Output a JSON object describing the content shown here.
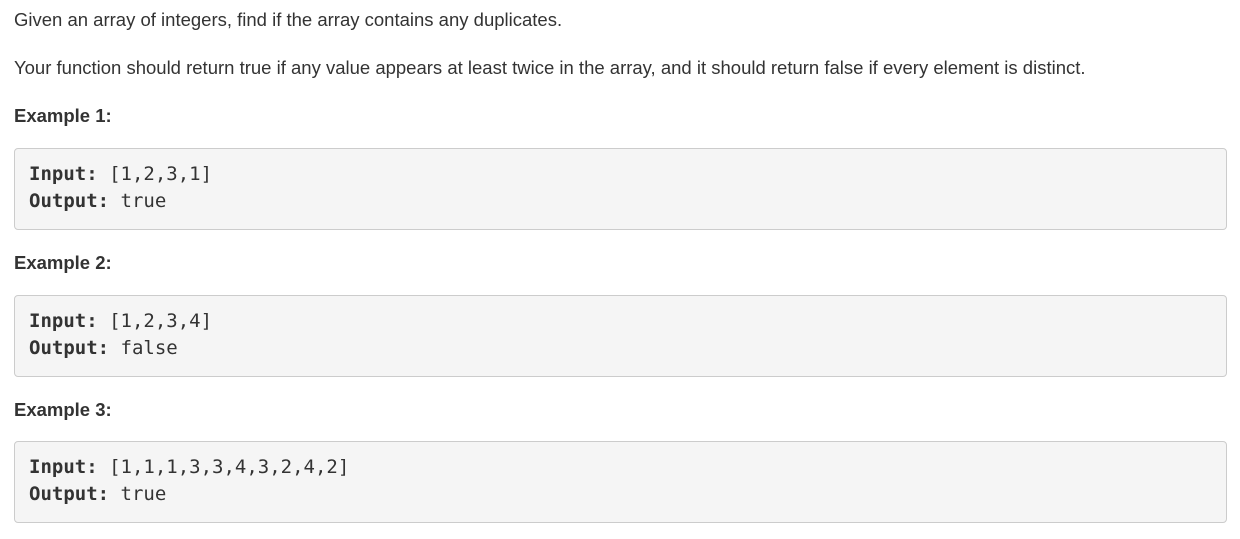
{
  "problem": {
    "statement": "Given an array of integers, find if the array contains any duplicates.",
    "description": "Your function should return true if any value appears at least twice in the array, and it should return false if every element is distinct."
  },
  "examples": [
    {
      "heading": "Example 1:",
      "input_label": "Input:",
      "input_value": " [1,2,3,1]",
      "output_label": "Output:",
      "output_value": " true"
    },
    {
      "heading": "Example 2:",
      "input_label": "Input:",
      "input_value": " [1,2,3,4]",
      "output_label": "Output:",
      "output_value": " false"
    },
    {
      "heading": "Example 3:",
      "input_label": "Input:",
      "input_value": " [1,1,1,3,3,4,3,2,4,2]",
      "output_label": "Output:",
      "output_value": " true"
    }
  ]
}
